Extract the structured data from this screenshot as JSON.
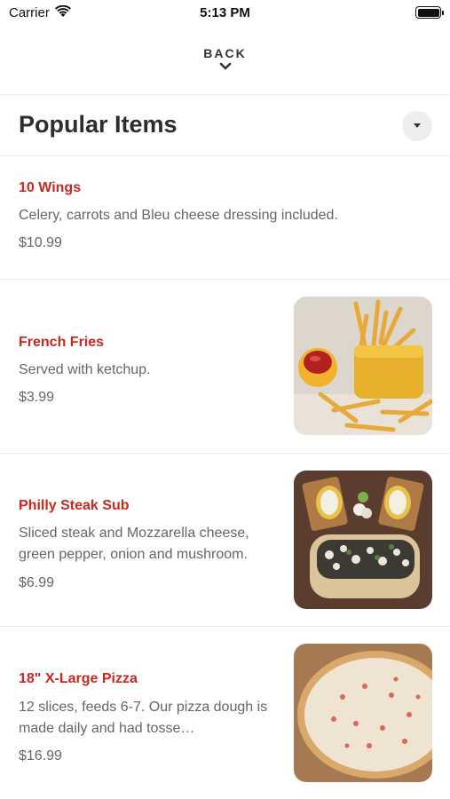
{
  "status_bar": {
    "carrier": "Carrier",
    "time": "5:13 PM"
  },
  "nav": {
    "back_label": "BACK"
  },
  "section": {
    "title": "Popular Items"
  },
  "items": [
    {
      "name": "10 Wings",
      "description": "Celery, carrots and Bleu cheese dressing included.",
      "price": "$10.99"
    },
    {
      "name": "French Fries",
      "description": "Served with ketchup.",
      "price": "$3.99"
    },
    {
      "name": "Philly Steak Sub",
      "description": "Sliced steak and Mozzarella cheese, green pepper, onion and mushroom.",
      "price": "$6.99"
    },
    {
      "name": "18\" X-Large Pizza",
      "description": "12 slices, feeds 6-7. Our pizza dough is made daily and had tosse…",
      "price": "$16.99"
    }
  ],
  "colors": {
    "accent": "#c8281e",
    "text": "#333333",
    "muted": "#666666"
  }
}
